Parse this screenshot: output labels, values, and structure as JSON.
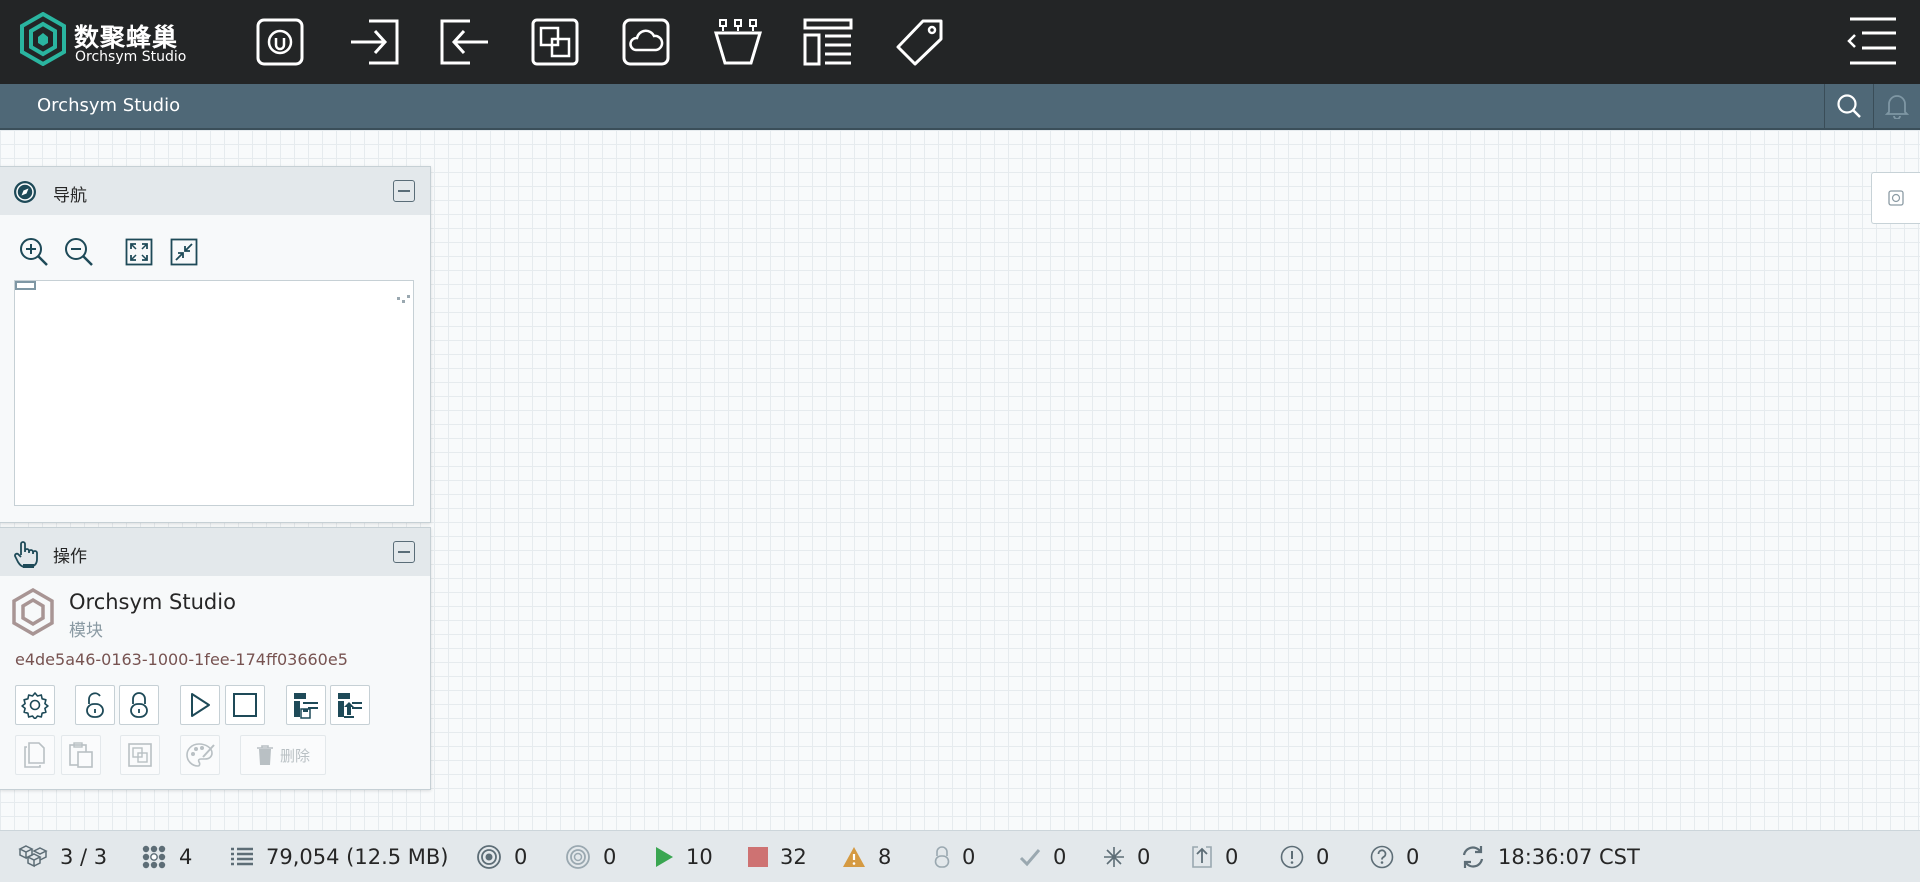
{
  "brand": {
    "name_cn": "数聚蜂巢",
    "name_en": "Orchsym Studio",
    "logo_color": "#2ab5a0"
  },
  "toolbar": {
    "icons": [
      "module-icon",
      "input-port-icon",
      "output-port-icon",
      "process-group-icon",
      "remote-group-icon",
      "funnel-icon",
      "template-icon",
      "label-icon"
    ]
  },
  "breadcrumb": {
    "title": "Orchsym Studio"
  },
  "navigation_panel": {
    "title": "导航"
  },
  "operation_panel": {
    "title": "操作",
    "component_name": "Orchsym Studio",
    "component_type": "模块",
    "component_id": "e4de5a46-0163-1000-1fee-174ff03660e5",
    "delete_label": "删除"
  },
  "status": {
    "cluster": "3 / 3",
    "threads": "4",
    "queued": "79,054 (12.5 MB)",
    "transmitting": "0",
    "not_transmitting": "0",
    "running": "10",
    "stopped": "32",
    "invalid": "8",
    "disabled": "0",
    "up_to_date": "0",
    "locally_modified": "0",
    "stale": "0",
    "locally_modified_stale": "0",
    "sync_failure": "0",
    "last_refreshed": "18:36:07 CST"
  },
  "colors": {
    "header_bg": "#232526",
    "breadcrumb_bg": "#4f6877",
    "running": "#3aa651",
    "stopped": "#ce7272",
    "invalid": "#d59a42",
    "id_text": "#775351"
  }
}
